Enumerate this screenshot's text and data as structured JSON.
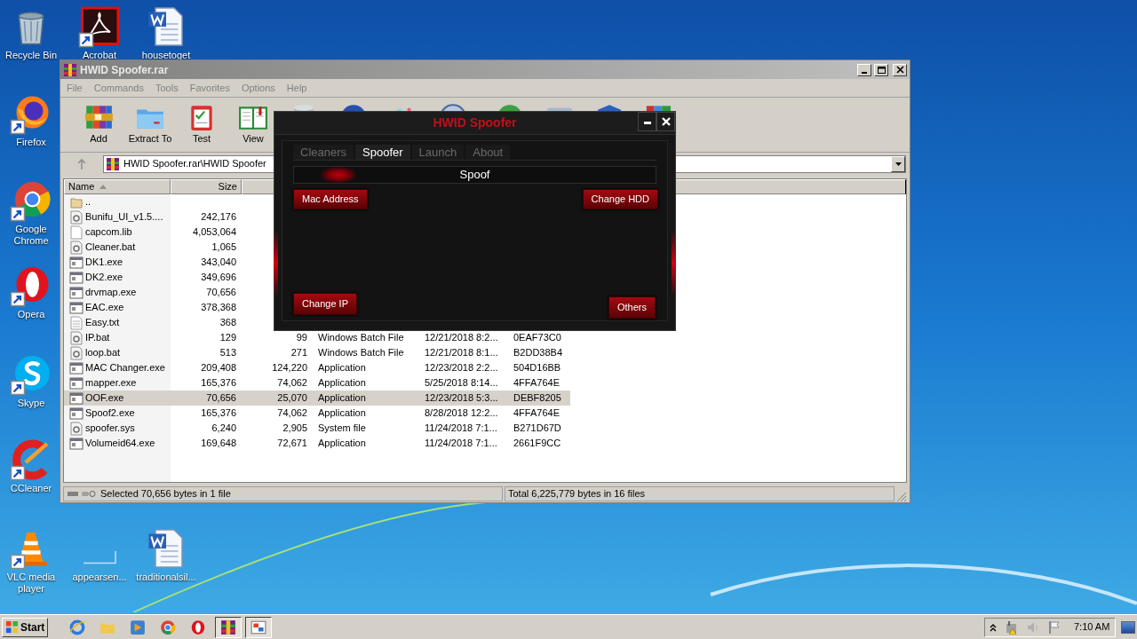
{
  "desktop": {
    "icons": [
      {
        "label": "Recycle Bin",
        "kind": "recycle"
      },
      {
        "label": "Acrobat",
        "kind": "acrobat"
      },
      {
        "label": "housetoget",
        "kind": "word"
      },
      {
        "label": "Firefox",
        "kind": "firefox"
      },
      {
        "label": "Google Chrome",
        "kind": "chrome"
      },
      {
        "label": "Opera",
        "kind": "opera"
      },
      {
        "label": "Skype",
        "kind": "skype"
      },
      {
        "label": "CCleaner",
        "kind": "ccleaner"
      },
      {
        "label": "VLC media player",
        "kind": "vlc"
      },
      {
        "label": "appearsen...",
        "kind": "blank"
      },
      {
        "label": "traditionalsil...",
        "kind": "word"
      }
    ]
  },
  "winrar": {
    "title": "HWID Spoofer.rar",
    "menu": [
      "File",
      "Commands",
      "Tools",
      "Favorites",
      "Options",
      "Help"
    ],
    "toolbar": [
      {
        "label": "Add",
        "kind": "add"
      },
      {
        "label": "Extract To",
        "kind": "extract"
      },
      {
        "label": "Test",
        "kind": "test"
      },
      {
        "label": "View",
        "kind": "view"
      }
    ],
    "path": "HWID Spoofer.rar\\HWID Spoofer",
    "columns": [
      "Name",
      "Size"
    ],
    "rows": [
      {
        "kind": "parent",
        "name": "..",
        "selected": false
      },
      {
        "kind": "gear",
        "name": "Bunifu_UI_v1.5....",
        "size": "242,176",
        "selected": false
      },
      {
        "kind": "file",
        "name": "capcom.lib",
        "size": "4,053,064",
        "selected": false
      },
      {
        "kind": "gear",
        "name": "Cleaner.bat",
        "size": "1,065",
        "selected": false
      },
      {
        "kind": "exe",
        "name": "DK1.exe",
        "size": "343,040",
        "selected": false
      },
      {
        "kind": "exe",
        "name": "DK2.exe",
        "size": "349,696",
        "selected": false
      },
      {
        "kind": "exe",
        "name": "drvmap.exe",
        "size": "70,656",
        "selected": false
      },
      {
        "kind": "exe",
        "name": "EAC.exe",
        "size": "378,368",
        "selected": false
      },
      {
        "kind": "text",
        "name": "Easy.txt",
        "size": "368",
        "selected": false
      },
      {
        "kind": "gear",
        "name": "IP.bat",
        "size": "129",
        "packed": "99",
        "type": "Windows Batch File",
        "modified": "12/21/2018 8:2...",
        "crc": "0EAF73C0",
        "selected": false
      },
      {
        "kind": "gear",
        "name": "loop.bat",
        "size": "513",
        "packed": "271",
        "type": "Windows Batch File",
        "modified": "12/21/2018 8:1...",
        "crc": "B2DD38B4",
        "selected": false
      },
      {
        "kind": "exe",
        "name": "MAC Changer.exe",
        "size": "209,408",
        "packed": "124,220",
        "type": "Application",
        "modified": "12/23/2018 2:2...",
        "crc": "504D16BB",
        "selected": false
      },
      {
        "kind": "exe",
        "name": "mapper.exe",
        "size": "165,376",
        "packed": "74,062",
        "type": "Application",
        "modified": "5/25/2018 8:14...",
        "crc": "4FFA764E",
        "selected": false
      },
      {
        "kind": "exe",
        "name": "OOF.exe",
        "size": "70,656",
        "packed": "25,070",
        "type": "Application",
        "modified": "12/23/2018 5:3...",
        "crc": "DEBF8205",
        "selected": true
      },
      {
        "kind": "exe",
        "name": "Spoof2.exe",
        "size": "165,376",
        "packed": "74,062",
        "type": "Application",
        "modified": "8/28/2018 12:2...",
        "crc": "4FFA764E",
        "selected": false
      },
      {
        "kind": "gear",
        "name": "spoofer.sys",
        "size": "6,240",
        "packed": "2,905",
        "type": "System file",
        "modified": "11/24/2018 7:1...",
        "crc": "B271D67D",
        "selected": false
      },
      {
        "kind": "exe",
        "name": "Volumeid64.exe",
        "size": "169,648",
        "packed": "72,671",
        "type": "Application",
        "modified": "11/24/2018 7:1...",
        "crc": "2661F9CC",
        "selected": false
      }
    ],
    "status_left": "Selected 70,656 bytes in 1 file",
    "status_right": "Total 6,225,779 bytes in 16 files"
  },
  "spoofer": {
    "title": "HWID Spoofer",
    "tabs": [
      {
        "label": "Cleaners",
        "selected": false
      },
      {
        "label": "Spoofer",
        "selected": true
      },
      {
        "label": "Launch",
        "selected": false
      },
      {
        "label": "About",
        "selected": false
      }
    ],
    "bar_label": "Spoof",
    "buttons": [
      "Mac Address",
      "Change HDD",
      "Change IP",
      "Others"
    ]
  },
  "taskbar": {
    "start": "Start",
    "clock": "7:10 AM"
  }
}
